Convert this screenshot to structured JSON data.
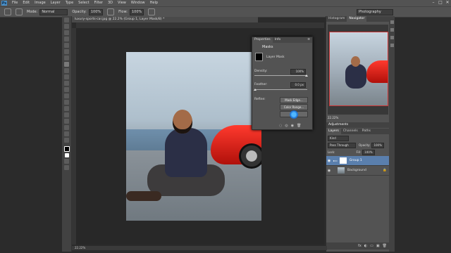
{
  "app": {
    "logo": "Ps"
  },
  "menu": [
    "File",
    "Edit",
    "Image",
    "Layer",
    "Type",
    "Select",
    "Filter",
    "3D",
    "View",
    "Window",
    "Help"
  ],
  "window_controls": [
    "–",
    "□",
    "✕"
  ],
  "options_bar": {
    "mode_label": "Mode:",
    "mode_value": "Normal",
    "opacity_label": "Opacity:",
    "opacity_value": "100%",
    "flow_label": "Flow:",
    "flow_value": "100%"
  },
  "workspace": "Photography",
  "document": {
    "tab_title": "luxury-sports-car.jpg @ 22.2% (Group 1, Layer Mask/8) *",
    "zoom_status": "22.22%"
  },
  "properties_panel": {
    "tabs": [
      "Properties",
      "Info"
    ],
    "title": "Masks",
    "layer_mask_label": "Layer Mask",
    "density_label": "Density:",
    "density_value": "100%",
    "feather_label": "Feather:",
    "feather_value": "0.0 px",
    "refine_label": "Refine:",
    "buttons": [
      "Mask Edge...",
      "Color Range...",
      "Invert"
    ]
  },
  "right_panel": {
    "top_tabs": [
      "Histogram",
      "Navigator"
    ],
    "nav_zoom": "22.22%",
    "adjustments_tab": "Adjustments",
    "layers_tabs": [
      "Layers",
      "Channels",
      "Paths"
    ],
    "kind_label": "Kind",
    "blend_mode": "Pass Through",
    "opacity_label": "Opacity:",
    "opacity_value": "100%",
    "lock_label": "Lock:",
    "fill_label": "Fill:",
    "fill_value": "100%",
    "layers": [
      {
        "name": "Group 1",
        "selected": true
      },
      {
        "name": "Background",
        "selected": false
      }
    ],
    "footer_icons": [
      "fx",
      "◐",
      "▭",
      "▣",
      "🗑"
    ]
  },
  "colors": {
    "accent": "#5a7fad",
    "car_red": "#e8231a"
  }
}
